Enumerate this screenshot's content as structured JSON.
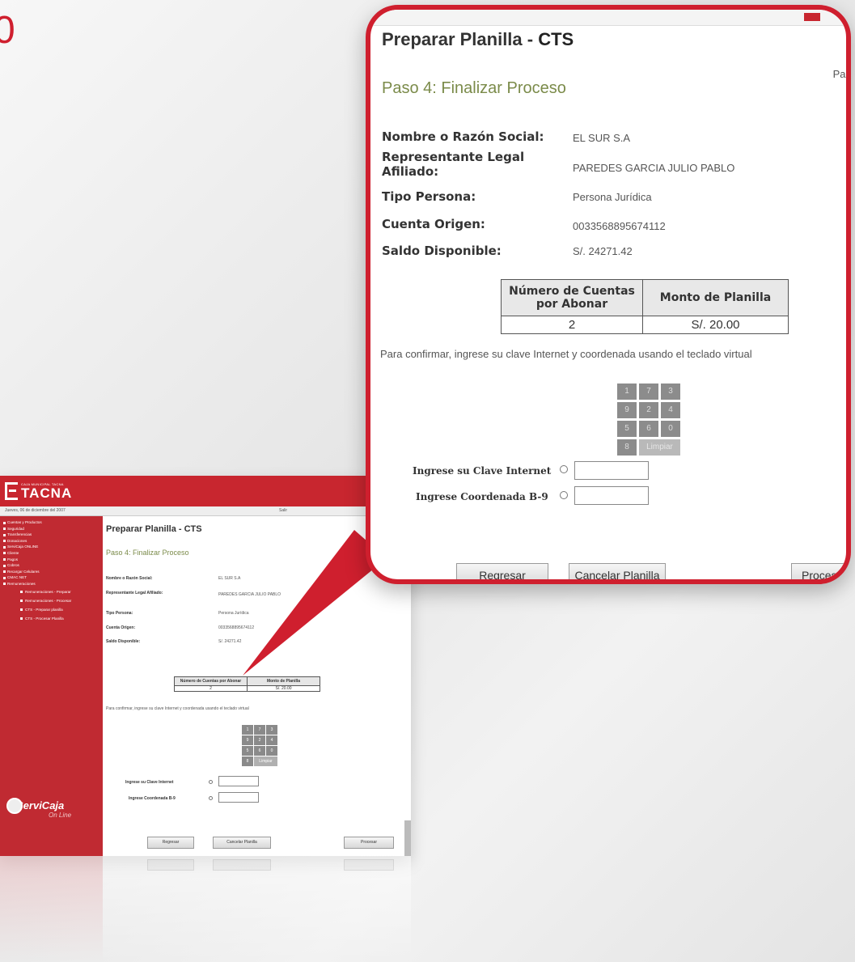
{
  "step_number": "0",
  "colors": {
    "brand_red": "#cf1f2e",
    "header_red": "#c8262f",
    "sidebar_red": "#c02a32",
    "paso_green": "#7b8b4a"
  },
  "callout": {
    "title_prefix": "Preparar Planilla - ",
    "title_suffix": "CTS",
    "paso_corner": "Pas",
    "paso": "Paso 4: Finalizar Proceso",
    "fields": [
      {
        "label": "Nombre o Razón Social:",
        "value": "EL SUR S.A"
      },
      {
        "label": "Representante Legal Afiliado:",
        "value": "PAREDES GARCIA JULIO PABLO"
      },
      {
        "label": "Tipo Persona:",
        "value": "Persona Jurídica"
      },
      {
        "label": "Cuenta Origen:",
        "value": "0033568895674112"
      },
      {
        "label": "Saldo Disponible:",
        "value": "S/. 24271.42"
      }
    ],
    "table": {
      "headers": [
        "Número de Cuentas por Abonar",
        "Monto de Planilla"
      ],
      "row": [
        "2",
        "S/. 20.00"
      ]
    },
    "confirm_text": "Para confirmar, ingrese su clave Internet y coordenada usando el teclado virtual",
    "keypad": [
      "1",
      "7",
      "3",
      "9",
      "2",
      "4",
      "5",
      "6",
      "0",
      "8"
    ],
    "keypad_clear": "Limpiar",
    "clave_label": "Ingrese su Clave Internet",
    "coordenada_label": "Ingrese Coordenada B-9",
    "buttons": {
      "regresar": "Regresar",
      "cancelar": "Cancelar Planilla",
      "procesar": "Proces"
    }
  },
  "small": {
    "logo_tagline": "CAJA MUNICIPAL TACNA",
    "logo_name": "TACNA",
    "date": "Jueves, 06 de diciembre del 2007",
    "salir": "Salir",
    "menu": [
      "Cuentas y Productos",
      "Seguridad",
      "Transferencias",
      "Donaciones",
      "ServiCaja ONLINE",
      "Cliente",
      "Pagos",
      "Cobros",
      "Recargar Celulares",
      "CMAC NET",
      "Remuneraciones"
    ],
    "submenu": [
      "Remuneraciones - Preparar",
      "Remuneraciones - Procesar",
      "CTS - Preparar planilla",
      "CTS - Procesar Planilla"
    ],
    "brand": "ServiCaja",
    "brand_sub": "On Line",
    "title": "Preparar Planilla - CTS",
    "paso": "Paso 4: Finalizar Proceso",
    "fields": [
      {
        "label": "Nombre o Razón Social:",
        "value": "EL SUR S.A"
      },
      {
        "label": "Representante Legal Afiliado:",
        "value": "PAREDES GARCIA JULIO PABLO"
      },
      {
        "label": "Tipo Persona:",
        "value": "Persona Jurídica"
      },
      {
        "label": "Cuenta Origen:",
        "value": "0033568895674112"
      },
      {
        "label": "Saldo Disponible:",
        "value": "S/. 24271.42"
      }
    ],
    "table": {
      "headers": [
        "Número de Cuentas por Abonar",
        "Monto de Planilla"
      ],
      "row": [
        "2",
        "S/. 20.00"
      ]
    },
    "confirm_text": "Para confirmar, ingrese su clave Internet y coordenada usando el teclado virtual",
    "keypad": [
      "1",
      "7",
      "3",
      "9",
      "2",
      "4",
      "5",
      "6",
      "0",
      "8"
    ],
    "keypad_clear": "Limpiar",
    "clave_label": "Ingrese su Clave Internet",
    "coordenada_label": "Ingrese Coordenada B-9",
    "buttons": {
      "regresar": "Regresar",
      "cancelar": "Cancelar Planilla",
      "procesar": "Procesar"
    }
  }
}
